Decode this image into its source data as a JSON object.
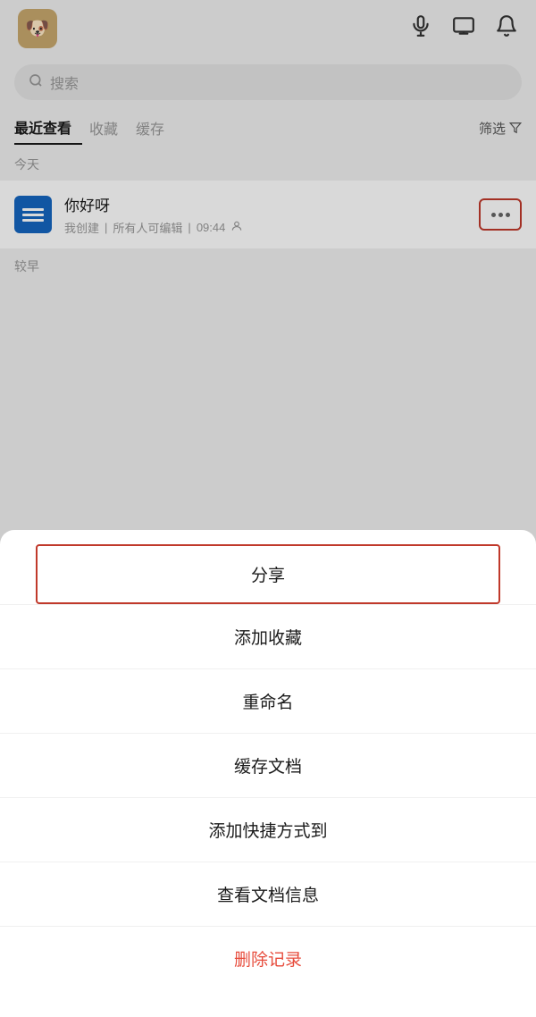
{
  "header": {
    "avatar_emoji": "🐶",
    "icons": {
      "mic": "🎤",
      "screen": "⊟",
      "bell": "🔔"
    }
  },
  "search": {
    "placeholder": "搜索"
  },
  "tabs": [
    {
      "id": "recent",
      "label": "最近查看",
      "active": true
    },
    {
      "id": "favorite",
      "label": "收藏",
      "active": false
    },
    {
      "id": "cache",
      "label": "缓存",
      "active": false
    }
  ],
  "filter_label": "筛选",
  "today_label": "今天",
  "earlier_label": "较早",
  "document": {
    "title": "你好呀",
    "meta_created": "我创建",
    "meta_separator": "|",
    "meta_editable": "所有人可编辑",
    "meta_time": "09:44",
    "meta_icon": "👤"
  },
  "menu": {
    "items": [
      {
        "id": "share",
        "label": "分享",
        "highlighted": true
      },
      {
        "id": "add-favorite",
        "label": "添加收藏"
      },
      {
        "id": "rename",
        "label": "重命名"
      },
      {
        "id": "cache-doc",
        "label": "缓存文档"
      },
      {
        "id": "add-shortcut",
        "label": "添加快捷方式到"
      },
      {
        "id": "view-info",
        "label": "查看文档信息"
      },
      {
        "id": "delete",
        "label": "删除记录",
        "delete": true
      }
    ]
  }
}
